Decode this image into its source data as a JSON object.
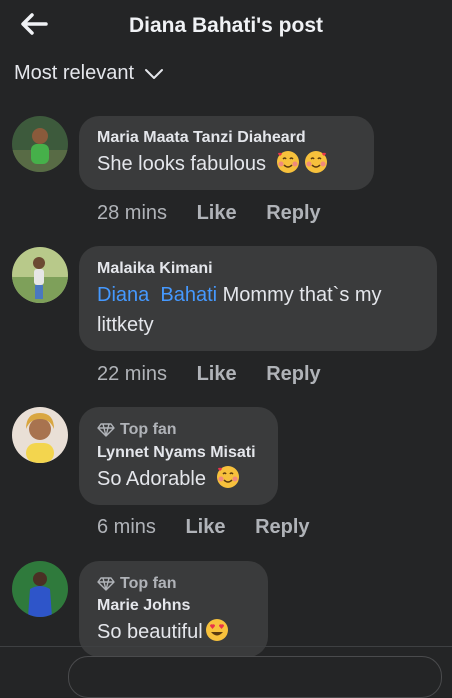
{
  "header": {
    "title": "Diana  Bahati's post"
  },
  "sort": {
    "label": "Most relevant"
  },
  "actions": {
    "like": "Like",
    "reply": "Reply"
  },
  "comments": [
    {
      "name": "Maria Maata Tanzi Diaheard",
      "text": "She looks fabulous",
      "emoji": "smiling-face-with-hearts",
      "time": "28 mins"
    },
    {
      "name": "Malaika Kimani",
      "mention": "Diana  Bahati",
      "text_after_mention": " Mommy that`s my",
      "text_line2": "littkety",
      "time": "22 mins"
    },
    {
      "badge": "Top fan",
      "name": "Lynnet Nyams Misati",
      "text": "So Adorable",
      "emoji": "smiling-face-with-hearts",
      "time": "6 mins"
    },
    {
      "badge": "Top fan",
      "name": "Marie Johns",
      "text": "So beautiful",
      "emoji": "heart-eyes"
    }
  ],
  "colors": {
    "background": "#242526",
    "bubble": "#3a3b3c",
    "mention": "#4599ff",
    "meta": "#b0b3b8"
  }
}
